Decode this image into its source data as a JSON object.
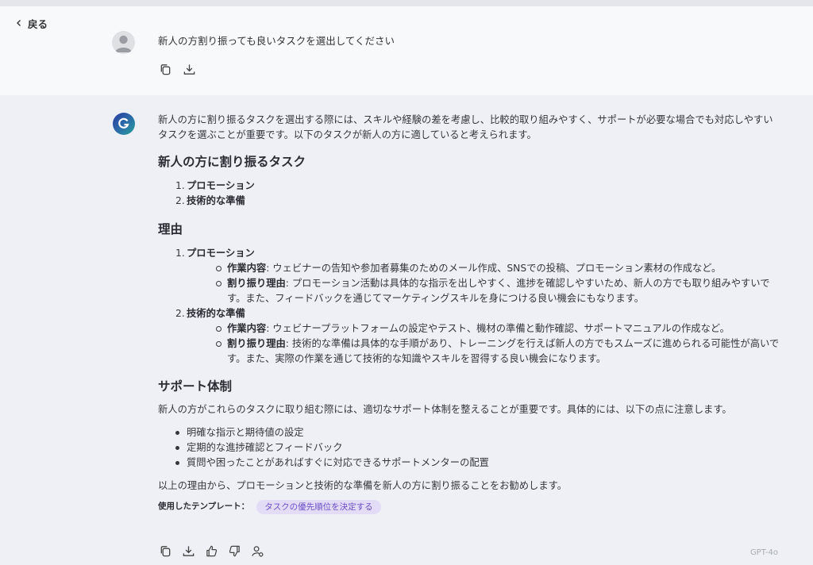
{
  "nav": {
    "back_label": "戻る"
  },
  "user_message": {
    "text": "新人の方割り振っても良いタスクを選出してください"
  },
  "assistant": {
    "intro": "新人の方に割り振るタスクを選出する際には、スキルや経験の差を考慮し、比較的取り組みやすく、サポートが必要な場合でも対応しやすいタスクを選ぶことが重要です。以下のタスクが新人の方に適していると考えられます。",
    "section1_title": "新人の方に割り振るタスク",
    "tasks": [
      {
        "num": "1.",
        "label": "プロモーション"
      },
      {
        "num": "2.",
        "label": "技術的な準備"
      }
    ],
    "section2_title": "理由",
    "reasons": [
      {
        "num": "1.",
        "label": "プロモーション",
        "work_key": "作業内容",
        "work_text": ": ウェビナーの告知や参加者募集のためのメール作成、SNSでの投稿、プロモーション素材の作成など。",
        "reason_key": "割り振り理由",
        "reason_text": ": プロモーション活動は具体的な指示を出しやすく、進捗を確認しやすいため、新人の方でも取り組みやすいです。また、フィードバックを通じてマーケティングスキルを身につける良い機会にもなります。"
      },
      {
        "num": "2.",
        "label": "技術的な準備",
        "work_key": "作業内容",
        "work_text": ": ウェビナープラットフォームの設定やテスト、機材の準備と動作確認、サポートマニュアルの作成など。",
        "reason_key": "割り振り理由",
        "reason_text": ": 技術的な準備は具体的な手順があり、トレーニングを行えば新人の方でもスムーズに進められる可能性が高いです。また、実際の作業を通じて技術的な知識やスキルを習得する良い機会になります。"
      }
    ],
    "section3_title": "サポート体制",
    "support_intro": "新人の方がこれらのタスクに取り組む際には、適切なサポート体制を整えることが重要です。具体的には、以下の点に注意します。",
    "support_items": [
      "明確な指示と期待値の設定",
      "定期的な進捗確認とフィードバック",
      "質問や困ったことがあればすぐに対応できるサポートメンターの配置"
    ],
    "conclusion": "以上の理由から、プロモーションと技術的な準備を新人の方に割り振ることをお勧めします。",
    "template_label": "使用したテンプレート：",
    "template_chip": "タスクの優先順位を決定する",
    "model_label": "GPT-4o"
  },
  "colors": {
    "chip_bg": "#e3dcf7",
    "chip_text": "#6b4fc8",
    "logo_gradient_start": "#2a3a9e",
    "logo_gradient_end": "#27a19b"
  },
  "icons": [
    "chevron-left-icon",
    "user-avatar-icon",
    "copy-icon",
    "download-icon",
    "thumbs-up-icon",
    "thumbs-down-icon",
    "user-settings-icon",
    "logo-g-icon"
  ]
}
